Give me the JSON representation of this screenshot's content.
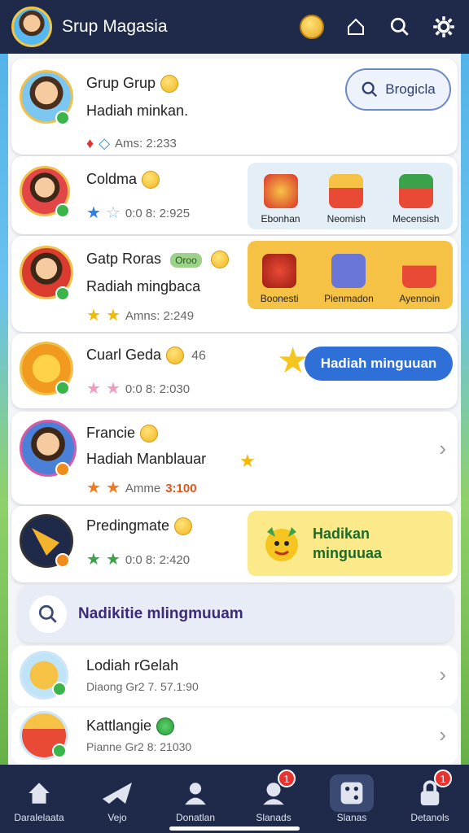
{
  "header": {
    "title": "Srup Magasia",
    "icons": [
      "avatar",
      "coin-icon",
      "home-icon",
      "search-icon",
      "gear-icon"
    ]
  },
  "rows": [
    {
      "name": "Grup Grup",
      "sub": "Hadiah minkan.",
      "meta": "Ams: 2:233",
      "button": "Brogicla"
    },
    {
      "name": "Coldma",
      "meta": "0:0 8: 2:925",
      "gifts": [
        "Ebonhan",
        "Neomish",
        "Mecensish"
      ]
    },
    {
      "name": "Gatp Roras",
      "tag": "Oroo",
      "sub": "Radiah mingbaca",
      "meta": "Amns: 2:249",
      "gifts": [
        "Boonesti",
        "Pienmadon",
        "Ayennoin"
      ]
    },
    {
      "name": "Cuarl Geda",
      "suffix": "46",
      "meta": "0:0 8: 2:030",
      "button": "Hadiah minguuan"
    },
    {
      "name": "Francie",
      "sub": "Hadiah Manblauar",
      "meta": "Amme",
      "meta_value": "3:100"
    },
    {
      "name": "Predingmate",
      "meta": "0:0 8: 2:420",
      "promo": "Hadikan minguuaa"
    },
    {
      "name": "Lodiah rGelah",
      "meta": "Diaong   Gr2 7. 57.1:90"
    },
    {
      "name": "Kattlangie",
      "meta": "Pianne   Gr2 8: 21030"
    }
  ],
  "search": {
    "label": "Nadikitie mlingmuuam"
  },
  "nav": [
    {
      "label": "Daralelaata",
      "icon": "home-icon"
    },
    {
      "label": "Vejo",
      "icon": "plane-icon"
    },
    {
      "label": "Donatlan",
      "icon": "person-icon"
    },
    {
      "label": "Slanads",
      "icon": "group-icon",
      "badge": "1"
    },
    {
      "label": "Slanas",
      "icon": "dice-icon"
    },
    {
      "label": "Detanols",
      "icon": "lock-icon",
      "badge": "1"
    }
  ],
  "colors": {
    "topbar": "#1f2a4a",
    "accent": "#2f6fd8",
    "gold": "#f6c245",
    "promo": "#fbe98a"
  }
}
